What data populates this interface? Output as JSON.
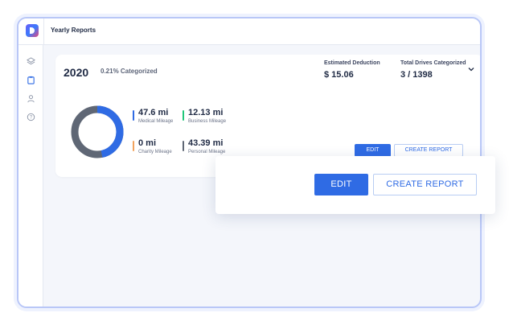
{
  "app": {
    "title": "Yearly Reports"
  },
  "sidebar": {
    "items": [
      {
        "icon": "layers-icon",
        "glyph": "≋"
      },
      {
        "icon": "clipboard-icon",
        "glyph": "▢"
      },
      {
        "icon": "user-icon",
        "glyph": "♙"
      },
      {
        "icon": "help-icon",
        "glyph": "?"
      }
    ]
  },
  "report": {
    "year": "2020",
    "categorized_pct": "0.21% Categorized",
    "estimated_deduction_label": "Estimated Deduction",
    "estimated_deduction_value": "$ 15.06",
    "drives_label": "Total Drives Categorized",
    "drives_value": "3 / 1398",
    "expand_glyph": "⌄"
  },
  "mileage": {
    "medical": {
      "value": "47.6 mi",
      "label": "Medical Mileage",
      "color": "#2f6be4"
    },
    "business": {
      "value": "12.13 mi",
      "label": "Business Mileage",
      "color": "#20c77a"
    },
    "charity": {
      "value": "0 mi",
      "label": "Charity Mileage",
      "color": "#f2a35e"
    },
    "personal": {
      "value": "43.39 mi",
      "label": "Personal Mileage",
      "color": "#5f6775"
    }
  },
  "actions": {
    "edit_label": "EDIT",
    "create_report_label": "CREATE REPORT"
  },
  "popup": {
    "edit_label": "EDIT",
    "create_report_label": "CREATE REPORT"
  },
  "colors": {
    "accent": "#2f6be4",
    "border": "#b9c7f7"
  }
}
